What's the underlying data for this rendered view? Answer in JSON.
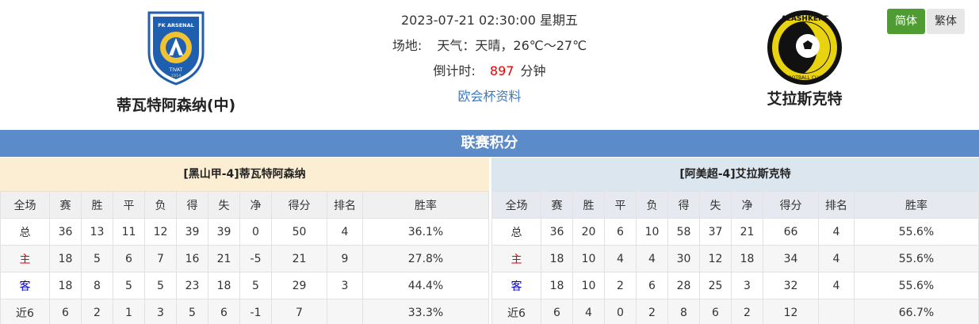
{
  "header": {
    "datetime": "2023-07-21 02:30:00 星期五",
    "venue_label": "场地:",
    "weather": "天气：天晴，26℃～27℃",
    "countdown_label": "倒计时:",
    "countdown_value": "897",
    "countdown_unit": "分钟",
    "cup_link": "欧会杯资料"
  },
  "home_team": {
    "name": "蒂瓦特阿森纳(中)",
    "logo_text_top": "FK ARSENAL",
    "logo_text_bottom": "TIVAT",
    "logo_year": "1914",
    "logo_color": "#1f5fb0"
  },
  "away_team": {
    "name": "艾拉斯克特",
    "logo_text_top": "ALASHKERT",
    "logo_text_bottom": "FOOTBALL CLUB",
    "logo_color": "#e9d20f"
  },
  "lang": {
    "simplified": "简体",
    "traditional": "繁体",
    "accent": "#4e9c32"
  },
  "standings": {
    "title": "联赛积分",
    "columns": [
      "全场",
      "赛",
      "胜",
      "平",
      "负",
      "得",
      "失",
      "净",
      "得分",
      "排名",
      "胜率"
    ],
    "home": {
      "title": "[黑山甲-4]蒂瓦特阿森纳",
      "rows": [
        [
          "总",
          "36",
          "13",
          "11",
          "12",
          "39",
          "39",
          "0",
          "50",
          "4",
          "36.1%"
        ],
        [
          "主",
          "18",
          "5",
          "6",
          "7",
          "16",
          "21",
          "-5",
          "21",
          "9",
          "27.8%"
        ],
        [
          "客",
          "18",
          "8",
          "5",
          "5",
          "23",
          "18",
          "5",
          "29",
          "3",
          "44.4%"
        ],
        [
          "近6",
          "6",
          "2",
          "1",
          "3",
          "5",
          "6",
          "-1",
          "7",
          "",
          "33.3%"
        ]
      ]
    },
    "away": {
      "title": "[阿美超-4]艾拉斯克特",
      "rows": [
        [
          "总",
          "36",
          "20",
          "6",
          "10",
          "58",
          "37",
          "21",
          "66",
          "4",
          "55.6%"
        ],
        [
          "主",
          "18",
          "10",
          "4",
          "4",
          "30",
          "12",
          "18",
          "34",
          "4",
          "55.6%"
        ],
        [
          "客",
          "18",
          "10",
          "2",
          "6",
          "28",
          "25",
          "3",
          "32",
          "4",
          "55.6%"
        ],
        [
          "近6",
          "6",
          "4",
          "0",
          "2",
          "8",
          "6",
          "2",
          "12",
          "",
          "66.7%"
        ]
      ]
    }
  }
}
